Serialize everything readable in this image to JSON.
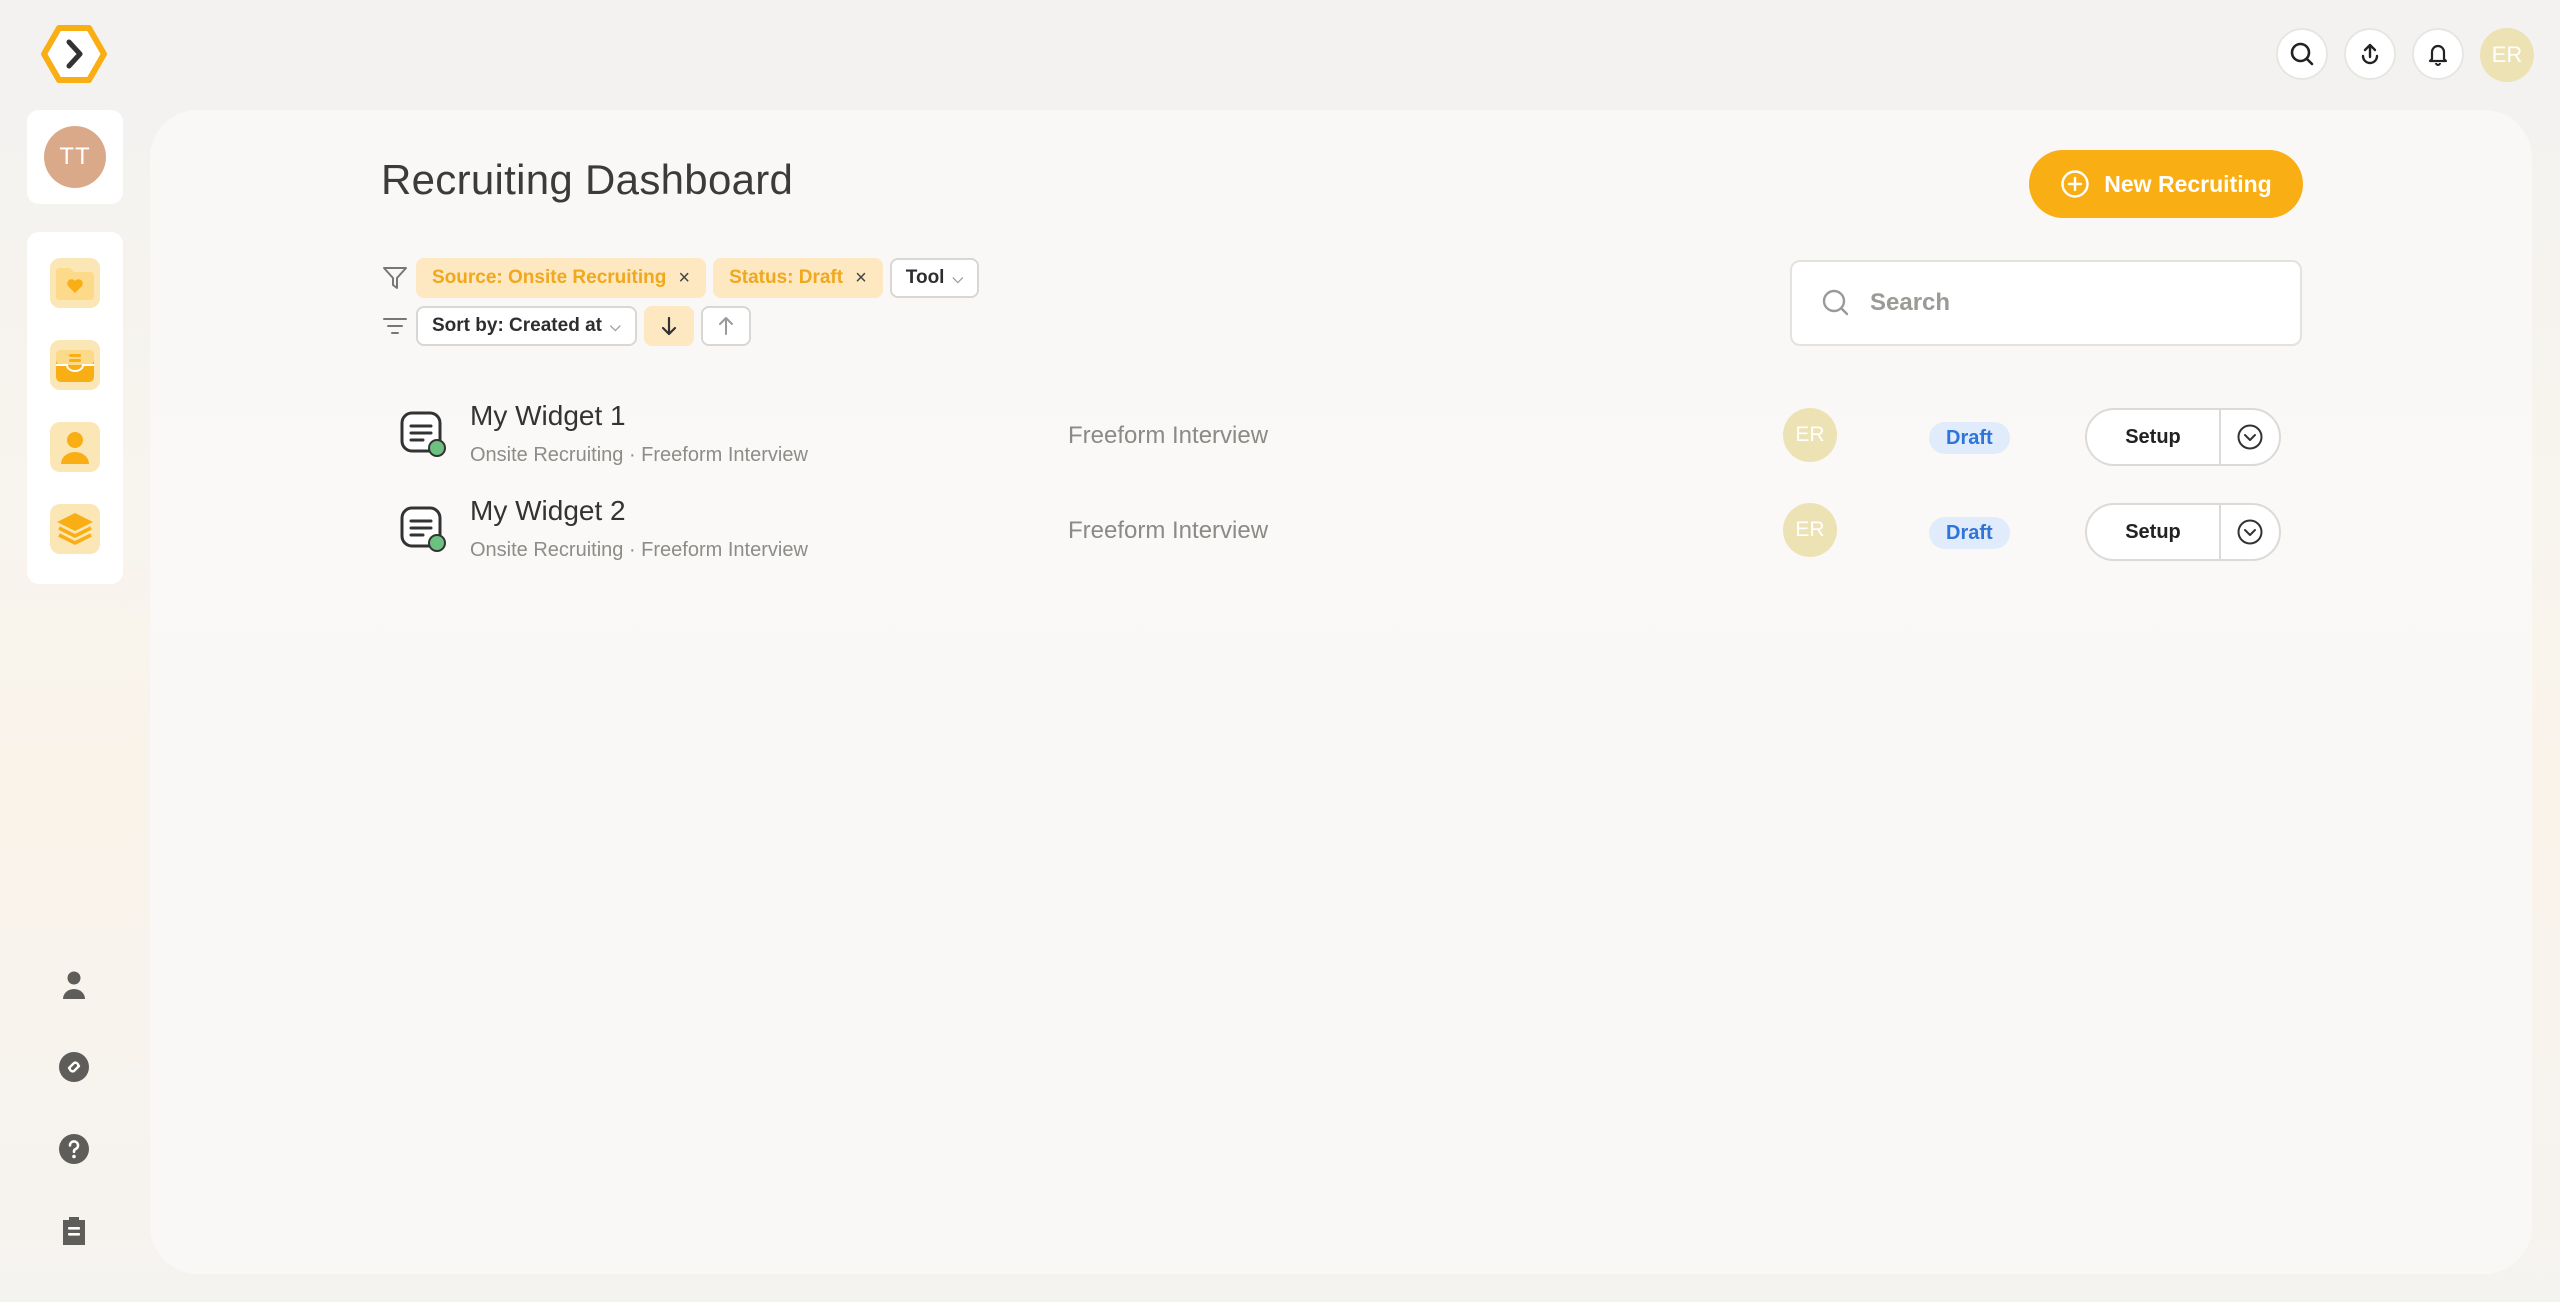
{
  "header": {
    "actions": [
      {
        "name": "search-icon"
      },
      {
        "name": "upload-icon"
      },
      {
        "name": "bell-icon"
      }
    ],
    "user_initials": "ER"
  },
  "sidebar": {
    "user_initials": "TT",
    "nav_items": [
      {
        "icon": "folder-heart-icon"
      },
      {
        "icon": "inbox-icon"
      },
      {
        "icon": "person-icon"
      },
      {
        "icon": "stack-icon"
      }
    ],
    "bottom_items": [
      {
        "icon": "user-icon"
      },
      {
        "icon": "link-icon"
      },
      {
        "icon": "help-icon"
      },
      {
        "icon": "clipboard-icon"
      }
    ]
  },
  "main": {
    "title": "Recruiting Dashboard",
    "new_button_label": "New Recruiting",
    "filters": [
      {
        "label": "Source: Onsite Recruiting",
        "remove": "×"
      },
      {
        "label": "Status: Draft",
        "remove": "×"
      }
    ],
    "tool_select": "Tool",
    "sort_select": "Sort by: Created at",
    "search_placeholder": "Search",
    "rows": [
      {
        "title": "My Widget 1",
        "subtitle": "Onsite Recruiting · Freeform Interview",
        "type": "Freeform Interview",
        "owner_initials": "ER",
        "status": "Draft",
        "action_label": "Setup"
      },
      {
        "title": "My Widget 2",
        "subtitle": "Onsite Recruiting · Freeform Interview",
        "type": "Freeform Interview",
        "owner_initials": "ER",
        "status": "Draft",
        "action_label": "Setup"
      }
    ]
  },
  "colors": {
    "accent": "#f9ae14",
    "chip_bg": "#fde8c2",
    "status_blue": "#2f74d9",
    "avatar_yellow": "#ede2b4"
  }
}
